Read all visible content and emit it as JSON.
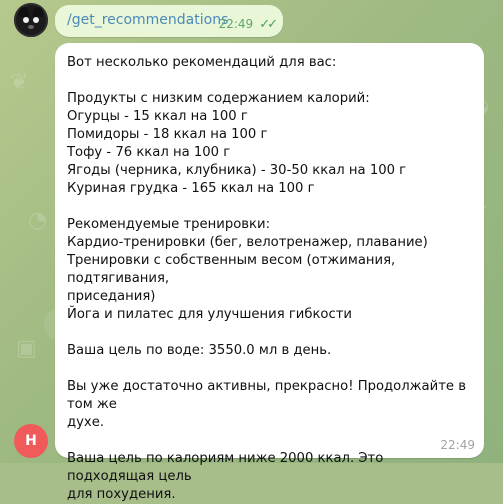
{
  "chat": {
    "command_message": "/get_recommendations",
    "command_time": "22:49",
    "reply_time": "22:49",
    "bot_avatar": "bot-avatar",
    "user_avatar_letter": "H",
    "reply_lines": [
      "Вот несколько рекомендаций для вас:",
      "",
      "Продукты с низким содержанием калорий:",
      "Огурцы - 15 ккал на 100 г",
      "Помидоры - 18 ккал на 100 г",
      "Тофу - 76 ккал на 100 г",
      "Ягоды (черника, клубника) - 30-50 ккал на 100 г",
      "Куриная грудка - 165 ккал на 100 г",
      "",
      "Рекомендуемые тренировки:",
      "Кардио-тренировки (бег, велотренажер, плавание)",
      "Тренировки с собственным весом (отжимания, подтягивания,",
      "приседания)",
      "Йога и пилатес для улучшения гибкости",
      "",
      "Ваша цель по воде: 3550.0 мл в день.",
      "",
      "Вы уже достаточно активны, прекрасно! Продолжайте в том же",
      "духе.",
      "",
      "Ваша цель по калориям ниже 2000 ккал. Это подходящая цель",
      "для похудения."
    ]
  },
  "icons": {
    "read_status": "double-check-icon",
    "background_pattern": "food-pattern-icon"
  },
  "colors": {
    "background": "#a7bd8a",
    "outgoing_bubble": "#e9f7d8",
    "incoming_bubble": "#ffffff",
    "command_link": "#4a89ba",
    "outgoing_meta": "#5fa66a",
    "user_avatar": "#f05a5a"
  }
}
